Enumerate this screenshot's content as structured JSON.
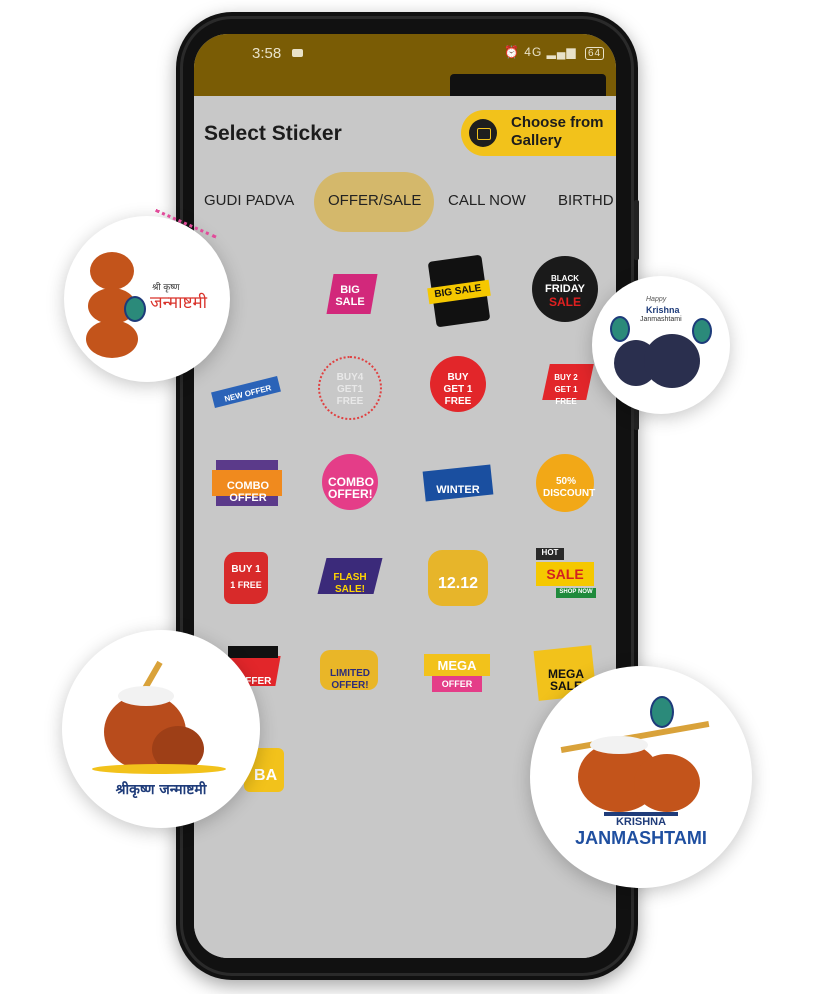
{
  "status_bar": {
    "time": "3:58",
    "network": "4G",
    "battery": "64"
  },
  "sheet": {
    "title": "Select Sticker",
    "gallery_button": "Choose from Gallery"
  },
  "tabs": [
    {
      "label": "GUDI PADVA",
      "active": false
    },
    {
      "label": "OFFER/SALE",
      "active": true
    },
    {
      "label": "CALL NOW",
      "active": false
    },
    {
      "label": "BIRTHD",
      "active": false
    }
  ],
  "stickers": {
    "big_sale": "BIG SALE",
    "big_sale_2": "BIG SALE",
    "black_friday_1": "BLACK",
    "black_friday_2": "FRIDAY",
    "black_friday_3": "SALE",
    "new_offer": "NEW OFFER",
    "buy4": "BUY4 GET1 FREE",
    "buy1get1": "BUY GET 1 FREE",
    "buy2get1": "BUY 2 GET 1 FREE",
    "combo1": "COMBO OFFER",
    "combo2": "COMBO OFFER!",
    "winter": "WINTER",
    "discount": "50% DISCOUNT",
    "buy1_1": "BUY 1",
    "buy1_2": "1 FREE",
    "flash": "FLASH SALE!",
    "twelve": "12.12",
    "hot": "HOT",
    "sale": "SALE",
    "shop_now": "SHOP NOW",
    "offer": "OFFER",
    "limited": "LIMITED OFFER!",
    "mega_offer_1": "MEGA",
    "mega_offer_2": "OFFER",
    "mega_sale": "MEGA SALE",
    "partial": "BA"
  },
  "overlays": {
    "shri_krishna_small": "श्री कृष्ण",
    "janmashtami": "जन्माष्टमी",
    "happy": "Happy",
    "krishna": "Krishna",
    "janmashtami_en": "Janmashtami",
    "shri_krishna_janmashtami": "श्रीकृष्ण जन्माष्टमी",
    "krishna_caps": "KRISHNA",
    "janmashtami_caps": "JANMASHTAMI"
  },
  "colors": {
    "accent": "#f2c21b",
    "status_bar": "#7a5c05",
    "tab_active": "#d4b86b",
    "overlay": "#c8c8c8"
  }
}
